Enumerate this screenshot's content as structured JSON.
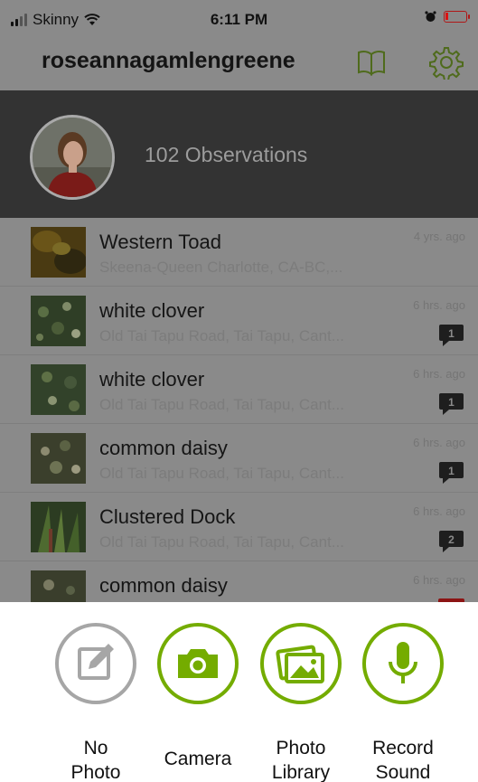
{
  "status_bar": {
    "carrier": "Skinny",
    "time": "6:11 PM"
  },
  "nav": {
    "title": "roseannagamlengreene",
    "icons": [
      "book-icon",
      "gear-icon"
    ]
  },
  "profile": {
    "observations_label": "102 Observations"
  },
  "observations": [
    {
      "name": "Western Toad",
      "place": "Skeena-Queen Charlotte, CA-BC,...",
      "time": "4 yrs. ago",
      "comments": null
    },
    {
      "name": "white clover",
      "place": "Old Tai Tapu Road, Tai Tapu, Cant...",
      "time": "6 hrs. ago",
      "comments": "1"
    },
    {
      "name": "white clover",
      "place": "Old Tai Tapu Road, Tai Tapu, Cant...",
      "time": "6 hrs. ago",
      "comments": "1"
    },
    {
      "name": "common daisy",
      "place": "Old Tai Tapu Road, Tai Tapu, Cant...",
      "time": "6 hrs. ago",
      "comments": "1"
    },
    {
      "name": "Clustered Dock",
      "place": "Old Tai Tapu Road, Tai Tapu, Cant...",
      "time": "6 hrs. ago",
      "comments": "2"
    },
    {
      "name": "common daisy",
      "place": "",
      "time": "6 hrs. ago",
      "comments": null
    }
  ],
  "actions": {
    "no_photo": {
      "line1": "No",
      "line2": "Photo"
    },
    "camera": {
      "line1": "Camera"
    },
    "photo_library": {
      "line1": "Photo",
      "line2": "Library"
    },
    "record_sound": {
      "line1": "Record",
      "line2": "Sound"
    }
  },
  "colors": {
    "accent_green": "#74ac00",
    "inactive_gray": "#a6a6a6",
    "overlay_gray": "#8a8a8a",
    "profile_dark": "#333333"
  }
}
